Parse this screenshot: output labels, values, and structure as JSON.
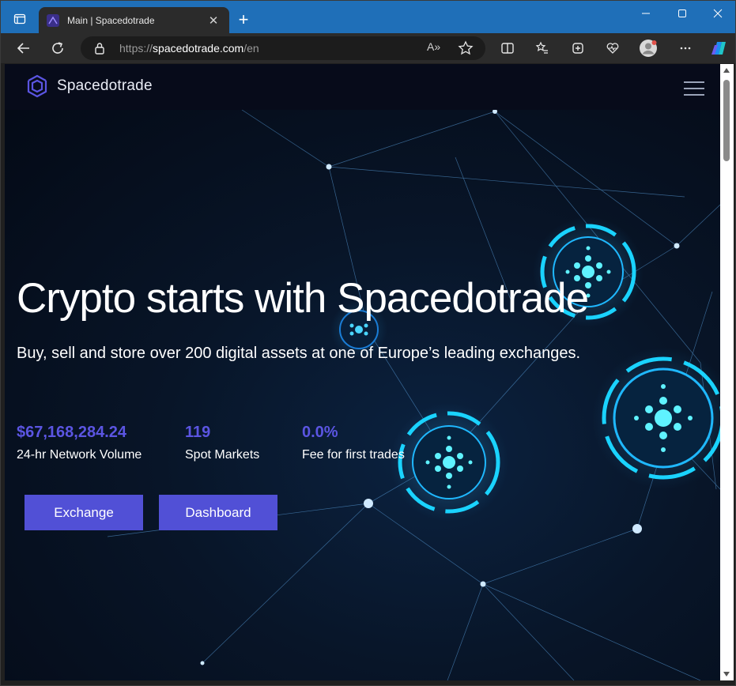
{
  "browser": {
    "tab_title": "Main | Spacedotrade",
    "tab_close": "✕",
    "new_tab": "+",
    "url_scheme": "https://",
    "url_host": "spacedotrade.com",
    "url_path": "/en",
    "read_aloud": "A»"
  },
  "site": {
    "brand": "Spacedotrade",
    "headline": "Crypto starts with Spacedotrade",
    "subline": "Buy, sell and store over 200 digital assets at one of Europe’s leading exchanges.",
    "stats": [
      {
        "value": "$67,168,284.24",
        "label": "24-hr Network Volume"
      },
      {
        "value": "119",
        "label": "Spot Markets"
      },
      {
        "value": "0.0%",
        "label": "Fee for first trades"
      }
    ],
    "buttons": {
      "exchange": "Exchange",
      "dashboard": "Dashboard"
    }
  },
  "colors": {
    "accent": "#5150d6",
    "stat_value": "#5b55e2",
    "titlebar": "#1f6fb8"
  }
}
